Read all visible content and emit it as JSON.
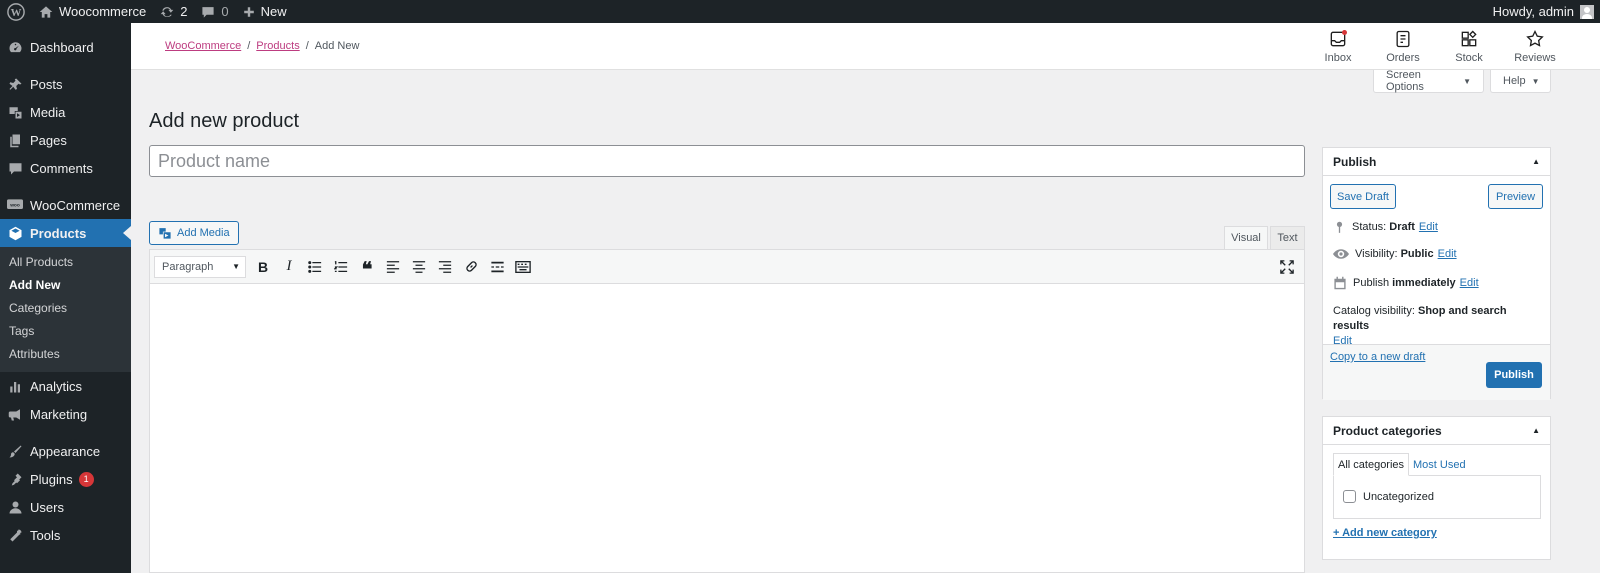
{
  "admin_bar": {
    "site_name": "Woocommerce",
    "updates_count": "2",
    "comments_count": "0",
    "new_label": "New",
    "howdy": "Howdy, admin"
  },
  "sidebar": {
    "items": [
      {
        "label": "Dashboard",
        "icon": "dashboard-icon"
      },
      {
        "label": "Posts",
        "icon": "pin-icon"
      },
      {
        "label": "Media",
        "icon": "media-icon"
      },
      {
        "label": "Pages",
        "icon": "pages-icon"
      },
      {
        "label": "Comments",
        "icon": "comments-icon"
      },
      {
        "label": "WooCommerce",
        "icon": "woocommerce-icon"
      },
      {
        "label": "Products",
        "icon": "products-icon"
      },
      {
        "label": "Analytics",
        "icon": "analytics-icon"
      },
      {
        "label": "Marketing",
        "icon": "megaphone-icon"
      },
      {
        "label": "Appearance",
        "icon": "brush-icon"
      },
      {
        "label": "Plugins",
        "icon": "plugin-icon",
        "badge": "1"
      },
      {
        "label": "Users",
        "icon": "users-icon"
      },
      {
        "label": "Tools",
        "icon": "wrench-icon"
      }
    ],
    "products_submenu": [
      "All Products",
      "Add New",
      "Categories",
      "Tags",
      "Attributes"
    ]
  },
  "breadcrumb": {
    "root": "WooCommerce",
    "parent": "Products",
    "current": "Add New"
  },
  "header_actions": [
    "Inbox",
    "Orders",
    "Stock",
    "Reviews"
  ],
  "screen_options_label": "Screen Options",
  "help_label": "Help",
  "page_title": "Add new product",
  "product_name_placeholder": "Product name",
  "editor": {
    "add_media_label": "Add Media",
    "tab_visual": "Visual",
    "tab_text": "Text",
    "format_select": "Paragraph"
  },
  "publish_box": {
    "title": "Publish",
    "save_draft": "Save Draft",
    "preview": "Preview",
    "status_label": "Status:",
    "status_value": "Draft",
    "visibility_label": "Visibility:",
    "visibility_value": "Public",
    "publish_label": "Publish",
    "publish_value": "immediately",
    "catalog_label": "Catalog visibility:",
    "catalog_value": "Shop and search results",
    "edit_label": "Edit",
    "copy_draft": "Copy to a new draft",
    "publish_button": "Publish"
  },
  "categories_box": {
    "title": "Product categories",
    "tab_all": "All categories",
    "tab_most_used": "Most Used",
    "items": [
      "Uncategorized"
    ],
    "add_new": "+ Add new category"
  },
  "colors": {
    "accent": "#2271b1",
    "sidebar_bg": "#1d2327",
    "breadcrumb_link": "#bd3c80"
  }
}
